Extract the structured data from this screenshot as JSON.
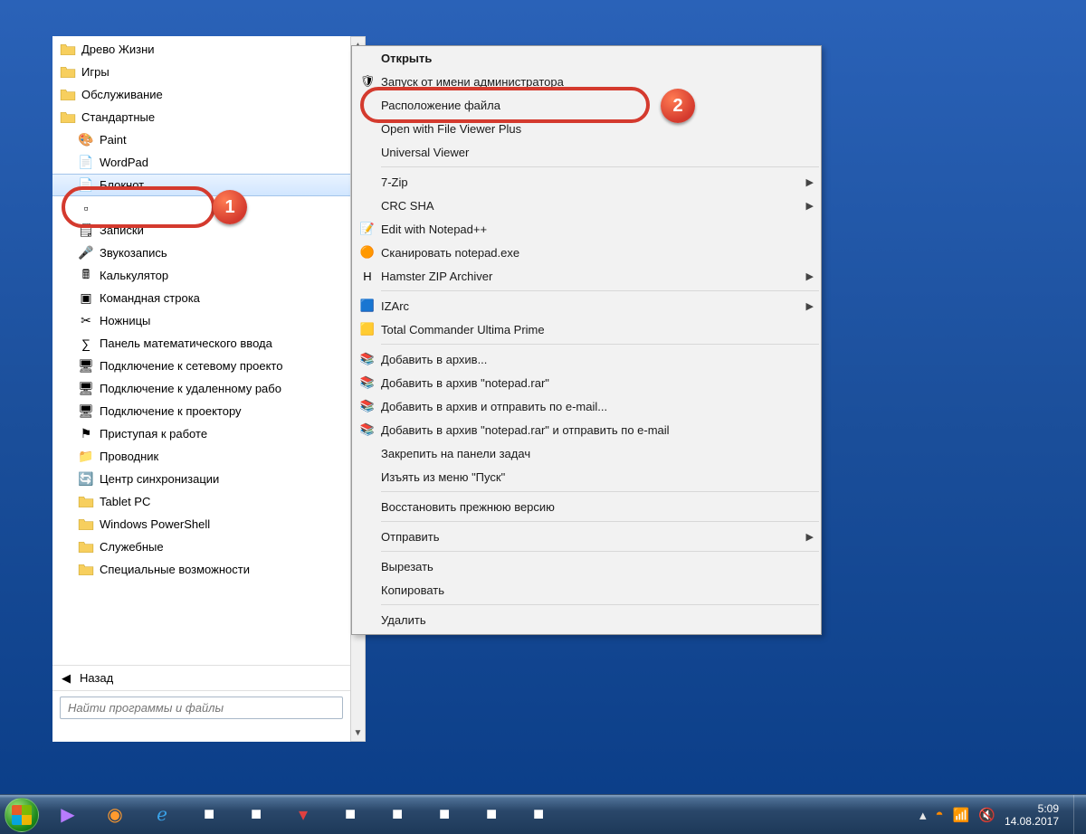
{
  "startmenu": {
    "items": [
      {
        "label": "Древо Жизни",
        "type": "folder",
        "indent": false
      },
      {
        "label": "Игры",
        "type": "folder",
        "indent": false
      },
      {
        "label": "Обслуживание",
        "type": "folder",
        "indent": false
      },
      {
        "label": "Стандартные",
        "type": "folder",
        "indent": false
      },
      {
        "label": "Paint",
        "type": "app",
        "icon": "paint",
        "indent": true
      },
      {
        "label": "WordPad",
        "type": "app",
        "icon": "wordpad",
        "indent": true
      },
      {
        "label": "Блокнот",
        "type": "app",
        "icon": "notepad",
        "indent": true,
        "highlight": true
      },
      {
        "label": "",
        "type": "app",
        "icon": "blank",
        "indent": true
      },
      {
        "label": "Записки",
        "type": "app",
        "icon": "notes",
        "indent": true
      },
      {
        "label": "Звукозапись",
        "type": "app",
        "icon": "mic",
        "indent": true
      },
      {
        "label": "Калькулятор",
        "type": "app",
        "icon": "calc",
        "indent": true
      },
      {
        "label": "Командная строка",
        "type": "app",
        "icon": "cmd",
        "indent": true
      },
      {
        "label": "Ножницы",
        "type": "app",
        "icon": "snip",
        "indent": true
      },
      {
        "label": "Панель математического ввода",
        "type": "app",
        "icon": "math",
        "indent": true
      },
      {
        "label": "Подключение к сетевому проекто",
        "type": "app",
        "icon": "proj",
        "indent": true
      },
      {
        "label": "Подключение к удаленному рабо",
        "type": "app",
        "icon": "rdp",
        "indent": true
      },
      {
        "label": "Подключение к проектору",
        "type": "app",
        "icon": "proj2",
        "indent": true
      },
      {
        "label": "Приступая к работе",
        "type": "app",
        "icon": "flag",
        "indent": true
      },
      {
        "label": "Проводник",
        "type": "app",
        "icon": "explorer",
        "indent": true
      },
      {
        "label": "Центр синхронизации",
        "type": "app",
        "icon": "sync",
        "indent": true
      },
      {
        "label": "Tablet PC",
        "type": "folder",
        "indent": true
      },
      {
        "label": "Windows PowerShell",
        "type": "folder",
        "indent": true
      },
      {
        "label": "Служебные",
        "type": "folder",
        "indent": true
      },
      {
        "label": "Специальные возможности",
        "type": "folder",
        "indent": true
      }
    ],
    "back_label": "Назад",
    "search_placeholder": "Найти программы и файлы"
  },
  "context_menu": {
    "items": [
      {
        "label": "Открыть",
        "icon": "",
        "bold": true
      },
      {
        "label": "Запуск от имени администратора",
        "icon": "shield"
      },
      {
        "label": "Расположение файла",
        "icon": ""
      },
      {
        "label": "Open with File Viewer Plus",
        "icon": ""
      },
      {
        "label": "Universal Viewer",
        "icon": ""
      },
      {
        "sep": true
      },
      {
        "label": "7-Zip",
        "icon": "",
        "submenu": true
      },
      {
        "label": "CRC SHA",
        "icon": "",
        "submenu": true
      },
      {
        "label": "Edit with Notepad++",
        "icon": "npp"
      },
      {
        "label": "Сканировать notepad.exe",
        "icon": "avast"
      },
      {
        "label": "Hamster ZIP Archiver",
        "icon": "hamster",
        "submenu": true
      },
      {
        "sep": true
      },
      {
        "label": "IZArc",
        "icon": "izarc",
        "submenu": true
      },
      {
        "label": "Total Commander Ultima Prime",
        "icon": "tc"
      },
      {
        "sep": true
      },
      {
        "label": "Добавить в архив...",
        "icon": "winrar"
      },
      {
        "label": "Добавить в архив \"notepad.rar\"",
        "icon": "winrar"
      },
      {
        "label": "Добавить в архив и отправить по e-mail...",
        "icon": "winrar"
      },
      {
        "label": "Добавить в архив \"notepad.rar\" и отправить по e-mail",
        "icon": "winrar"
      },
      {
        "label": "Закрепить на панели задач",
        "icon": ""
      },
      {
        "label": "Изъять из меню \"Пуск\"",
        "icon": ""
      },
      {
        "sep": true
      },
      {
        "label": "Восстановить прежнюю версию",
        "icon": ""
      },
      {
        "sep": true
      },
      {
        "label": "Отправить",
        "icon": "",
        "submenu": true
      },
      {
        "sep": true
      },
      {
        "label": "Вырезать",
        "icon": ""
      },
      {
        "label": "Копировать",
        "icon": ""
      },
      {
        "sep": true
      },
      {
        "label": "Удалить",
        "icon": ""
      }
    ]
  },
  "annotations": {
    "n1": "1",
    "n2": "2"
  },
  "taskbar": {
    "time": "5:09",
    "date": "14.08.2017"
  }
}
